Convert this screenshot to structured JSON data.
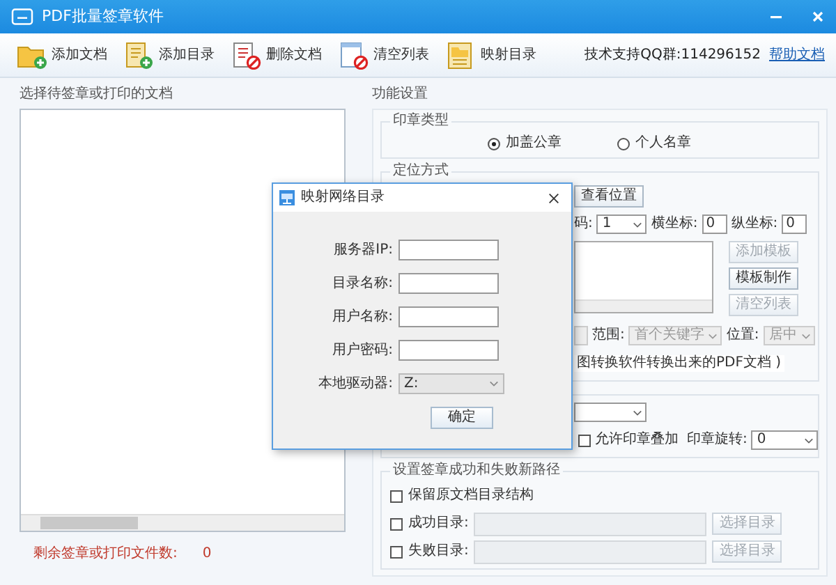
{
  "window": {
    "title": "PDF批量签章软件"
  },
  "toolbar": [
    {
      "label": "添加文档",
      "kind": "add-file"
    },
    {
      "label": "添加目录",
      "kind": "add-folder"
    },
    {
      "label": "删除文档",
      "kind": "delete"
    },
    {
      "label": "清空列表",
      "kind": "clear"
    },
    {
      "label": "映射目录",
      "kind": "map"
    }
  ],
  "support": {
    "text": "技术支持QQ群:114296152",
    "link": "帮助文档"
  },
  "left_panel": {
    "title": "选择待签章或打印的文档",
    "remaining_label": "剩余签章或打印文件数:",
    "remaining_count": "0"
  },
  "settings": {
    "title": "功能设置",
    "seal_type": {
      "legend": "印章类型",
      "options": [
        {
          "label": "加盖公章",
          "selected": true
        },
        {
          "label": "个人名章",
          "selected": false
        }
      ]
    },
    "positioning": {
      "legend": "定位方式",
      "view_button": "查看位置",
      "page_label": "码:",
      "page_value": "1",
      "x_label": "横坐标:",
      "x_value": "0",
      "y_label": "纵坐标:",
      "y_value": "0",
      "buttons": [
        {
          "label": "添加模板",
          "disabled": true
        },
        {
          "label": "模板制作",
          "disabled": false
        },
        {
          "label": "清空列表",
          "disabled": true
        }
      ],
      "range_label": "范围:",
      "range_value": "首个关键字",
      "position_label": "位置:",
      "position_value": "居中",
      "note": "图转换软件转换出来的PDF文档 )"
    },
    "seal_options": {
      "overlap": {
        "label": "允许印章叠加",
        "checked": false
      },
      "rotate_label": "印章旋转:",
      "rotate_value": "0"
    },
    "paths": {
      "legend": "设置签章成功和失败新路径",
      "keep_structure": {
        "label": "保留原文档目录结构",
        "checked": false
      },
      "rows": [
        {
          "label": "成功目录:",
          "checked": false,
          "button": "选择目录"
        },
        {
          "label": "失败目录:",
          "checked": false,
          "button": "选择目录"
        }
      ]
    }
  },
  "dialog": {
    "title": "映射网络目录",
    "fields": [
      {
        "label": "服务器IP:"
      },
      {
        "label": "目录名称:"
      },
      {
        "label": "用户名称:"
      },
      {
        "label": "用户密码:"
      }
    ],
    "drive": {
      "label": "本地驱动器:",
      "value": "Z:"
    },
    "ok": "确定"
  }
}
